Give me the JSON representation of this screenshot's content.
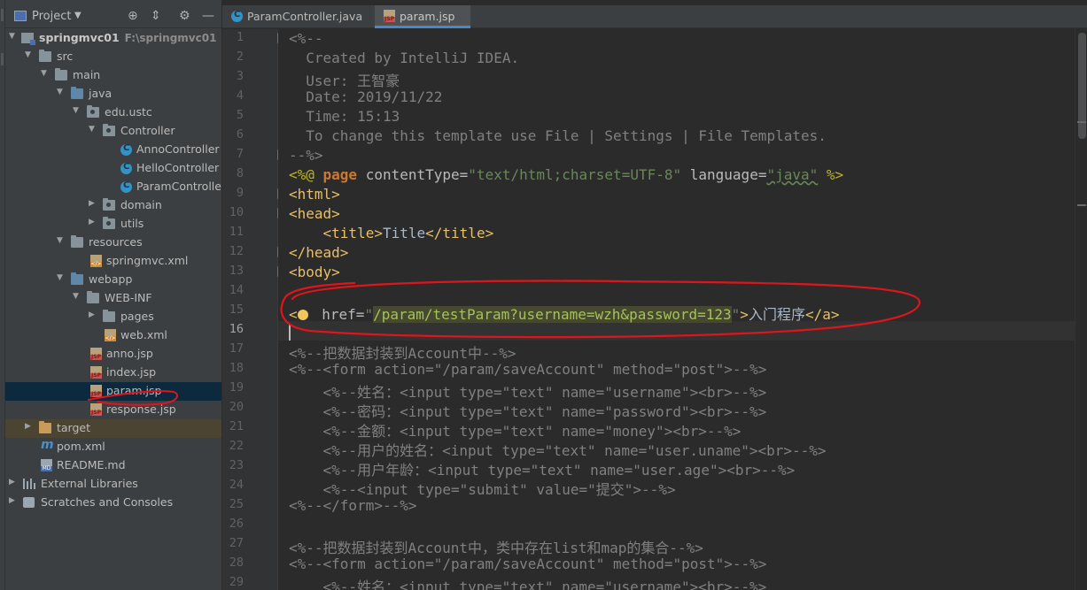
{
  "project_panel": {
    "title": "Project",
    "tree": [
      {
        "label": "springmvc01",
        "sub": "F:\\springmvc01"
      },
      {
        "label": "src"
      },
      {
        "label": "main"
      },
      {
        "label": "java"
      },
      {
        "label": "edu.ustc"
      },
      {
        "label": "Controller"
      },
      {
        "label": "AnnoController"
      },
      {
        "label": "HelloController"
      },
      {
        "label": "ParamController"
      },
      {
        "label": "domain"
      },
      {
        "label": "utils"
      },
      {
        "label": "resources"
      },
      {
        "label": "springmvc.xml"
      },
      {
        "label": "webapp"
      },
      {
        "label": "WEB-INF"
      },
      {
        "label": "pages"
      },
      {
        "label": "web.xml"
      },
      {
        "label": "anno.jsp"
      },
      {
        "label": "index.jsp"
      },
      {
        "label": "param.jsp"
      },
      {
        "label": "response.jsp"
      },
      {
        "label": "target"
      },
      {
        "label": "pom.xml"
      },
      {
        "label": "README.md"
      },
      {
        "label": "External Libraries"
      },
      {
        "label": "Scratches and Consoles"
      }
    ]
  },
  "tabs": [
    {
      "label": "ParamController.java",
      "active": false
    },
    {
      "label": "param.jsp",
      "active": true
    }
  ],
  "editor": {
    "current_line": 16,
    "line_numbers": [
      "1",
      "2",
      "3",
      "4",
      "5",
      "6",
      "7",
      "8",
      "9",
      "10",
      "11",
      "12",
      "13",
      "14",
      "15",
      "16",
      "17",
      "18",
      "19",
      "20",
      "21",
      "22",
      "23",
      "24",
      "25",
      "26",
      "27",
      "28",
      "29"
    ],
    "code": {
      "l1": "<%--",
      "l2": "  Created by IntelliJ IDEA.",
      "l3": "  User: 王智豪",
      "l4": "  Date: 2019/11/22",
      "l5": "  Time: 15:13",
      "l6": "  To change this template use File | Settings | File Templates.",
      "l7": "--%>",
      "l8a": "<%@ ",
      "l8b": "page",
      "l8c": " contentType=",
      "l8d": "\"text/html;charset=UTF-8\"",
      "l8e": " language=",
      "l8f": "\"java\"",
      "l8g": " %>",
      "l9": "<html>",
      "l10": "<head>",
      "l11a": "    <title>",
      "l11b": "Title",
      "l11c": "</title>",
      "l12": "</head>",
      "l13": "<body>",
      "l15a": "<",
      "l15b": " href=",
      "l15c": "\"",
      "l15d": "/param/testParam?username=wzh&password=123",
      "l15e": "\"",
      "l15f": ">",
      "l15g": "入门程序",
      "l15h": "</a>",
      "l17": "<%--把数据封装到Account中--%>",
      "l18": "<%--<form action=\"/param/saveAccount\" method=\"post\">--%>",
      "l19": "    <%--姓名：<input type=\"text\" name=\"username\"><br>--%>",
      "l20": "    <%--密码：<input type=\"text\" name=\"password\"><br>--%>",
      "l21": "    <%--金额：<input type=\"text\" name=\"money\"><br>--%>",
      "l22": "    <%--用户的姓名：<input type=\"text\" name=\"user.uname\"><br>--%>",
      "l23": "    <%--用户年龄：<input type=\"text\" name=\"user.age\"><br>--%>",
      "l24": "    <%--<input type=\"submit\" value=\"提交\">--%>",
      "l25": "<%--</form>--%>",
      "l27": "<%--把数据封装到Account中，类中存在list和map的集合--%>",
      "l28": "<%--<form action=\"/param/saveAccount\" method=\"post\">--%>",
      "l29": "    <%--姓名：<input type=\"text\" name=\"username\"><br>--%>"
    }
  },
  "colors": {
    "background": "#2b2b2b",
    "panel": "#3c3f41",
    "selection": "#0d293e",
    "annotation": "#e0151b",
    "active_tab_underline": "#4a88c7"
  }
}
